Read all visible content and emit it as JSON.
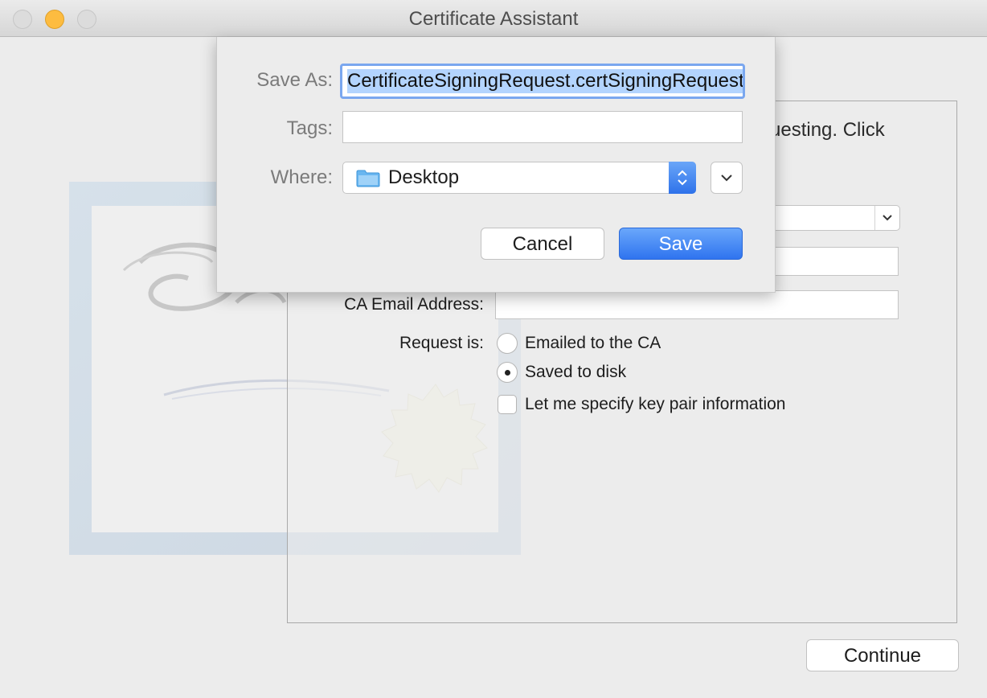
{
  "window": {
    "title": "Certificate Assistant",
    "traffic_lights": [
      "close-icon",
      "minimize-icon",
      "zoom-icon"
    ],
    "accent_color": "#2f74ef"
  },
  "main": {
    "instruction_fragment": "uesting. Click",
    "fields": {
      "ca_email_label": "CA Email Address:",
      "request_label": "Request is:"
    },
    "request_options": [
      {
        "label": "Emailed to the CA",
        "selected": false
      },
      {
        "label": "Saved to disk",
        "selected": true
      }
    ],
    "key_pair_checkbox": {
      "label": "Let me specify key pair information",
      "checked": false
    },
    "continue_label": "Continue"
  },
  "save_sheet": {
    "save_as_label": "Save As:",
    "save_as_value": "CertificateSigningRequest.certSigningRequest",
    "tags_label": "Tags:",
    "tags_value": "",
    "where_label": "Where:",
    "where_value": "Desktop",
    "where_icon": "folder-icon",
    "cancel_label": "Cancel",
    "save_label": "Save"
  }
}
